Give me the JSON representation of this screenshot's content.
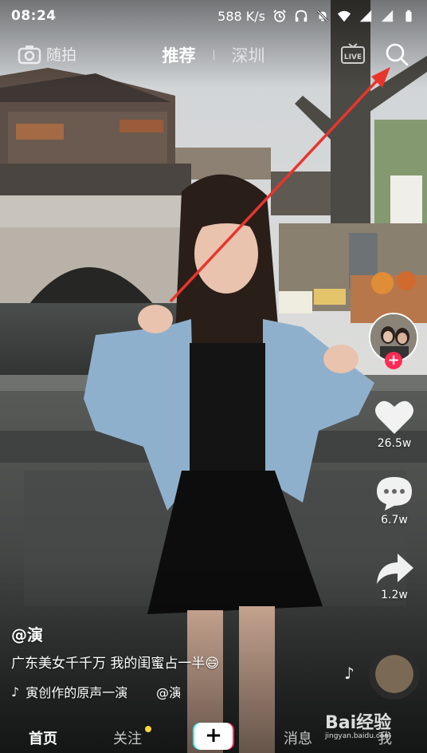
{
  "status_bar": {
    "time": "08:24",
    "network_speed": "588 K/s",
    "icons": [
      "alarm-icon",
      "headphones-icon",
      "mute-bell-icon",
      "wifi-icon",
      "signal-icon",
      "signal-icon",
      "battery-icon"
    ]
  },
  "top_nav": {
    "camera_label": "随拍",
    "tab_recommended": "推荐",
    "tab_local": "深圳",
    "live_label": "LIVE",
    "icons": [
      "camera-icon",
      "live-icon",
      "search-icon"
    ]
  },
  "right_rail": {
    "likes": "26.5w",
    "comments": "6.7w",
    "shares": "1.2w",
    "follow_symbol": "+"
  },
  "caption": {
    "author": "@演",
    "description": "广东美女千千万 我的闺蜜占一半😄",
    "music": "寅创作的原声一演",
    "mention": "@演"
  },
  "bottom_nav": {
    "home": "首页",
    "follow": "关注",
    "create": "+",
    "messages": "消息",
    "me": "我"
  },
  "watermark": {
    "brand": "Bai经验",
    "url": "jingyan.baidu.com"
  },
  "colors": {
    "accent_red": "#fe2c55",
    "accent_cyan": "#25f4ee",
    "notification_dot": "#f8d93a",
    "annotation_arrow": "#e8352e"
  }
}
